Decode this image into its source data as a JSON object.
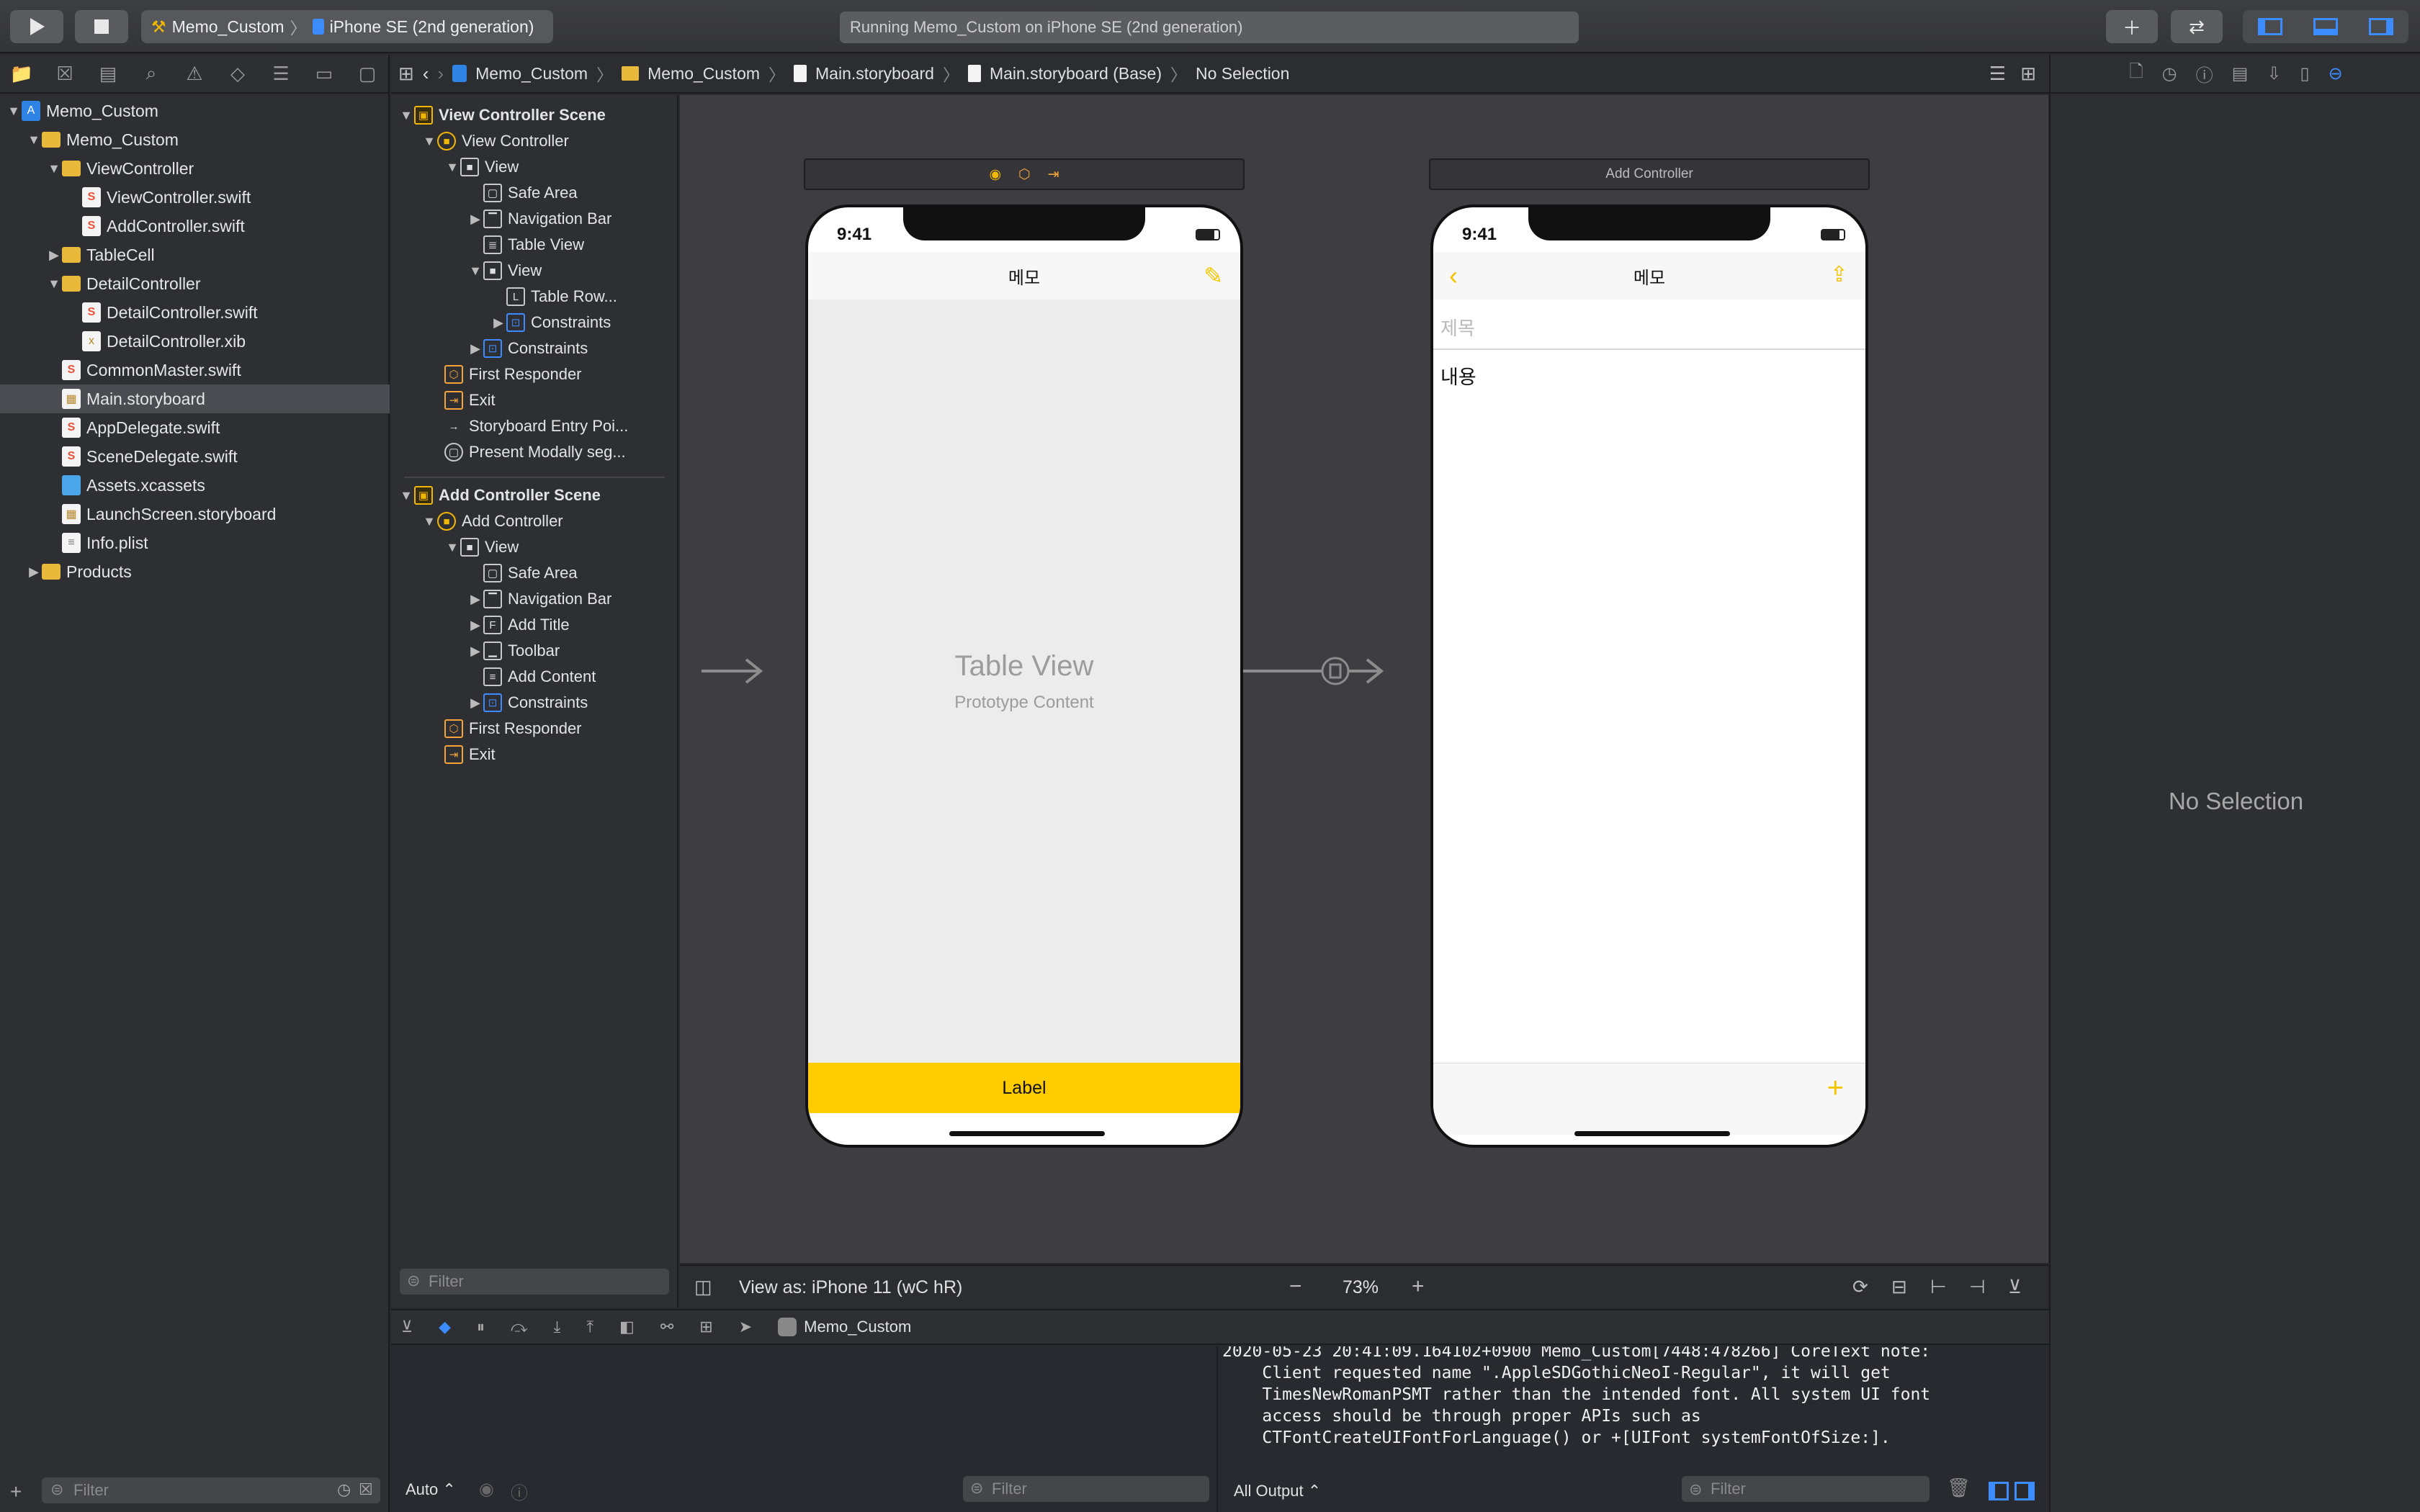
{
  "toolbar": {
    "scheme_project": "Memo_Custom",
    "scheme_device": "iPhone SE (2nd generation)",
    "activity": "Running Memo_Custom on iPhone SE (2nd generation)"
  },
  "navigator": {
    "items": [
      {
        "label": "Memo_Custom",
        "type": "proj"
      },
      {
        "label": "Memo_Custom",
        "type": "folder"
      },
      {
        "label": "ViewController",
        "type": "folder"
      },
      {
        "label": "ViewController.swift",
        "type": "swift"
      },
      {
        "label": "AddController.swift",
        "type": "swift"
      },
      {
        "label": "TableCell",
        "type": "folder"
      },
      {
        "label": "DetailController",
        "type": "folder"
      },
      {
        "label": "DetailController.swift",
        "type": "swift"
      },
      {
        "label": "DetailController.xib",
        "type": "swift"
      },
      {
        "label": "CommonMaster.swift",
        "type": "swift"
      },
      {
        "label": "Main.storyboard",
        "type": "sb"
      },
      {
        "label": "AppDelegate.swift",
        "type": "swift"
      },
      {
        "label": "SceneDelegate.swift",
        "type": "swift"
      },
      {
        "label": "Assets.xcassets",
        "type": "assets"
      },
      {
        "label": "LaunchScreen.storyboard",
        "type": "sb"
      },
      {
        "label": "Info.plist",
        "type": "plist"
      },
      {
        "label": "Products",
        "type": "folder"
      }
    ],
    "filter_placeholder": "Filter"
  },
  "jumpbar": {
    "crumbs": [
      "Memo_Custom",
      "Memo_Custom",
      "Main.storyboard",
      "Main.storyboard (Base)",
      "No Selection"
    ]
  },
  "outline": {
    "items": [
      "View Controller Scene",
      "View Controller",
      "View",
      "Safe Area",
      "Navigation Bar",
      "Table View",
      "View",
      "Table Row...",
      "Constraints",
      "Constraints",
      "First Responder",
      "Exit",
      "Storyboard Entry Poi...",
      "Present Modally seg...",
      "Add Controller Scene",
      "Add Controller",
      "View",
      "Safe Area",
      "Navigation Bar",
      "Add Title",
      "Toolbar",
      "Add Content",
      "Constraints",
      "First Responder",
      "Exit"
    ],
    "filter_placeholder": "Filter"
  },
  "canvas": {
    "scene2_title": "Add Controller",
    "time": "9:41",
    "nav_title": "메모",
    "table_view_title": "Table View",
    "table_view_sub": "Prototype Content",
    "label_text": "Label",
    "title_placeholder": "제목",
    "content_text": "내용",
    "view_as": "View as: iPhone 11 (wC hR)",
    "zoom": "73%"
  },
  "debug": {
    "process": "Memo_Custom",
    "vars_mode": "Auto",
    "output_mode": "All Output",
    "filter_placeholder": "Filter",
    "console_lines": [
      "2020-05-23 20:41:09.164102+0900 Memo_Custom[7448:478266] CoreText note:",
      "    Client requested name \".AppleSDGothicNeoI-Regular\", it will get",
      "    TimesNewRomanPSMT rather than the intended font. All system UI font",
      "    access should be through proper APIs such as",
      "    CTFontCreateUIFontForLanguage() or +[UIFont systemFontOfSize:]."
    ]
  },
  "inspector": {
    "empty_text": "No Selection"
  },
  "colors": {
    "accent": "#3c8cff",
    "label_bg": "#ffcc00",
    "ios_tint": "#f5c400"
  }
}
